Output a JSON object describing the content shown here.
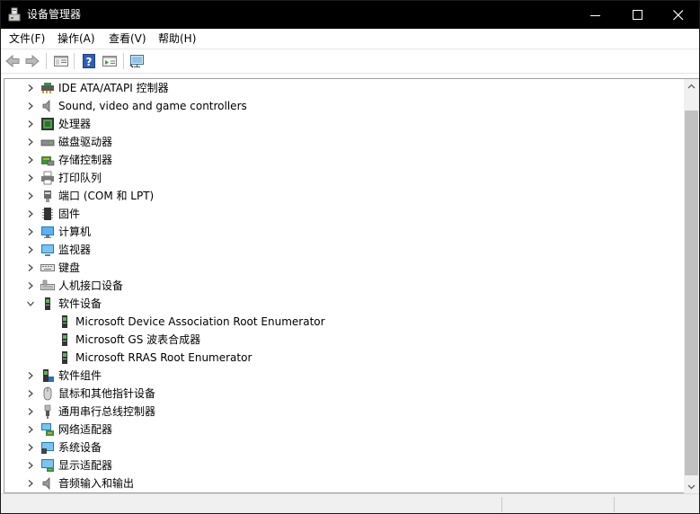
{
  "window": {
    "title": "设备管理器"
  },
  "menu": [
    "文件(F)",
    "操作(A)",
    "查看(V)",
    "帮助(H)"
  ],
  "toolbar": [
    "back",
    "forward",
    "properties",
    "help",
    "update-driver",
    "scan-hardware"
  ],
  "tree": [
    {
      "label": "IDE ATA/ATAPI 控制器",
      "icon": "ide-controller-icon",
      "expanded": false,
      "child": false
    },
    {
      "label": "Sound, video and game controllers",
      "icon": "speaker-icon",
      "expanded": false,
      "child": false
    },
    {
      "label": "处理器",
      "icon": "processor-icon",
      "expanded": false,
      "child": false
    },
    {
      "label": "磁盘驱动器",
      "icon": "disk-drive-icon",
      "expanded": false,
      "child": false
    },
    {
      "label": "存储控制器",
      "icon": "storage-controller-icon",
      "expanded": false,
      "child": false
    },
    {
      "label": "打印队列",
      "icon": "printer-icon",
      "expanded": false,
      "child": false
    },
    {
      "label": "端口 (COM 和 LPT)",
      "icon": "port-icon",
      "expanded": false,
      "child": false
    },
    {
      "label": "固件",
      "icon": "firmware-icon",
      "expanded": false,
      "child": false
    },
    {
      "label": "计算机",
      "icon": "computer-icon",
      "expanded": false,
      "child": false
    },
    {
      "label": "监视器",
      "icon": "monitor-icon",
      "expanded": false,
      "child": false
    },
    {
      "label": "键盘",
      "icon": "keyboard-icon",
      "expanded": false,
      "child": false
    },
    {
      "label": "人机接口设备",
      "icon": "hid-icon",
      "expanded": false,
      "child": false
    },
    {
      "label": "软件设备",
      "icon": "software-device-icon",
      "expanded": true,
      "child": false
    },
    {
      "label": "Microsoft Device Association Root Enumerator",
      "icon": "software-device-icon",
      "child": true
    },
    {
      "label": "Microsoft GS 波表合成器",
      "icon": "software-device-icon",
      "child": true
    },
    {
      "label": "Microsoft RRAS Root Enumerator",
      "icon": "software-device-icon",
      "child": true
    },
    {
      "label": "软件组件",
      "icon": "software-component-icon",
      "expanded": false,
      "child": false
    },
    {
      "label": "鼠标和其他指针设备",
      "icon": "mouse-icon",
      "expanded": false,
      "child": false
    },
    {
      "label": "通用串行总线控制器",
      "icon": "usb-icon",
      "expanded": false,
      "child": false
    },
    {
      "label": "网络适配器",
      "icon": "network-adapter-icon",
      "expanded": false,
      "child": false
    },
    {
      "label": "系统设备",
      "icon": "system-device-icon",
      "expanded": false,
      "child": false
    },
    {
      "label": "显示适配器",
      "icon": "display-adapter-icon",
      "expanded": false,
      "child": false
    },
    {
      "label": "音频输入和输出",
      "icon": "audio-icon",
      "expanded": false,
      "child": false
    }
  ]
}
